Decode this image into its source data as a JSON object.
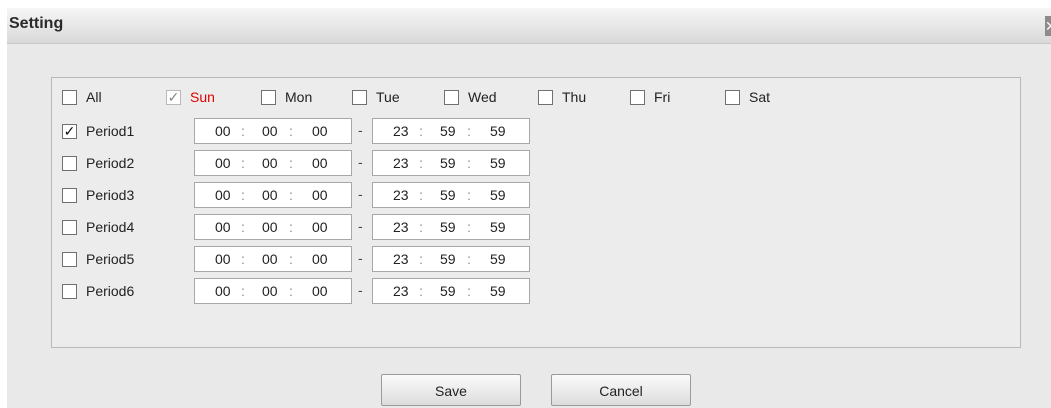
{
  "dialog": {
    "title": "Setting",
    "close_glyph": "✕"
  },
  "days": [
    {
      "label": "All",
      "checked": false,
      "selected": false,
      "disabled": false
    },
    {
      "label": "Sun",
      "checked": true,
      "selected": true,
      "disabled": true
    },
    {
      "label": "Mon",
      "checked": false,
      "selected": false,
      "disabled": false
    },
    {
      "label": "Tue",
      "checked": false,
      "selected": false,
      "disabled": false
    },
    {
      "label": "Wed",
      "checked": false,
      "selected": false,
      "disabled": false
    },
    {
      "label": "Thu",
      "checked": false,
      "selected": false,
      "disabled": false
    },
    {
      "label": "Fri",
      "checked": false,
      "selected": false,
      "disabled": false
    },
    {
      "label": "Sat",
      "checked": false,
      "selected": false,
      "disabled": false
    }
  ],
  "periods": [
    {
      "label": "Period1",
      "checked": true,
      "start": [
        "00",
        "00",
        "00"
      ],
      "end": [
        "23",
        "59",
        "59"
      ]
    },
    {
      "label": "Period2",
      "checked": false,
      "start": [
        "00",
        "00",
        "00"
      ],
      "end": [
        "23",
        "59",
        "59"
      ]
    },
    {
      "label": "Period3",
      "checked": false,
      "start": [
        "00",
        "00",
        "00"
      ],
      "end": [
        "23",
        "59",
        "59"
      ]
    },
    {
      "label": "Period4",
      "checked": false,
      "start": [
        "00",
        "00",
        "00"
      ],
      "end": [
        "23",
        "59",
        "59"
      ]
    },
    {
      "label": "Period5",
      "checked": false,
      "start": [
        "00",
        "00",
        "00"
      ],
      "end": [
        "23",
        "59",
        "59"
      ]
    },
    {
      "label": "Period6",
      "checked": false,
      "start": [
        "00",
        "00",
        "00"
      ],
      "end": [
        "23",
        "59",
        "59"
      ]
    }
  ],
  "time_separator": ":",
  "range_separator": "-",
  "check_glyph": "✓",
  "buttons": {
    "save_label": "Save",
    "cancel_label": "Cancel"
  },
  "colors": {
    "selected_day": "#e00000"
  }
}
